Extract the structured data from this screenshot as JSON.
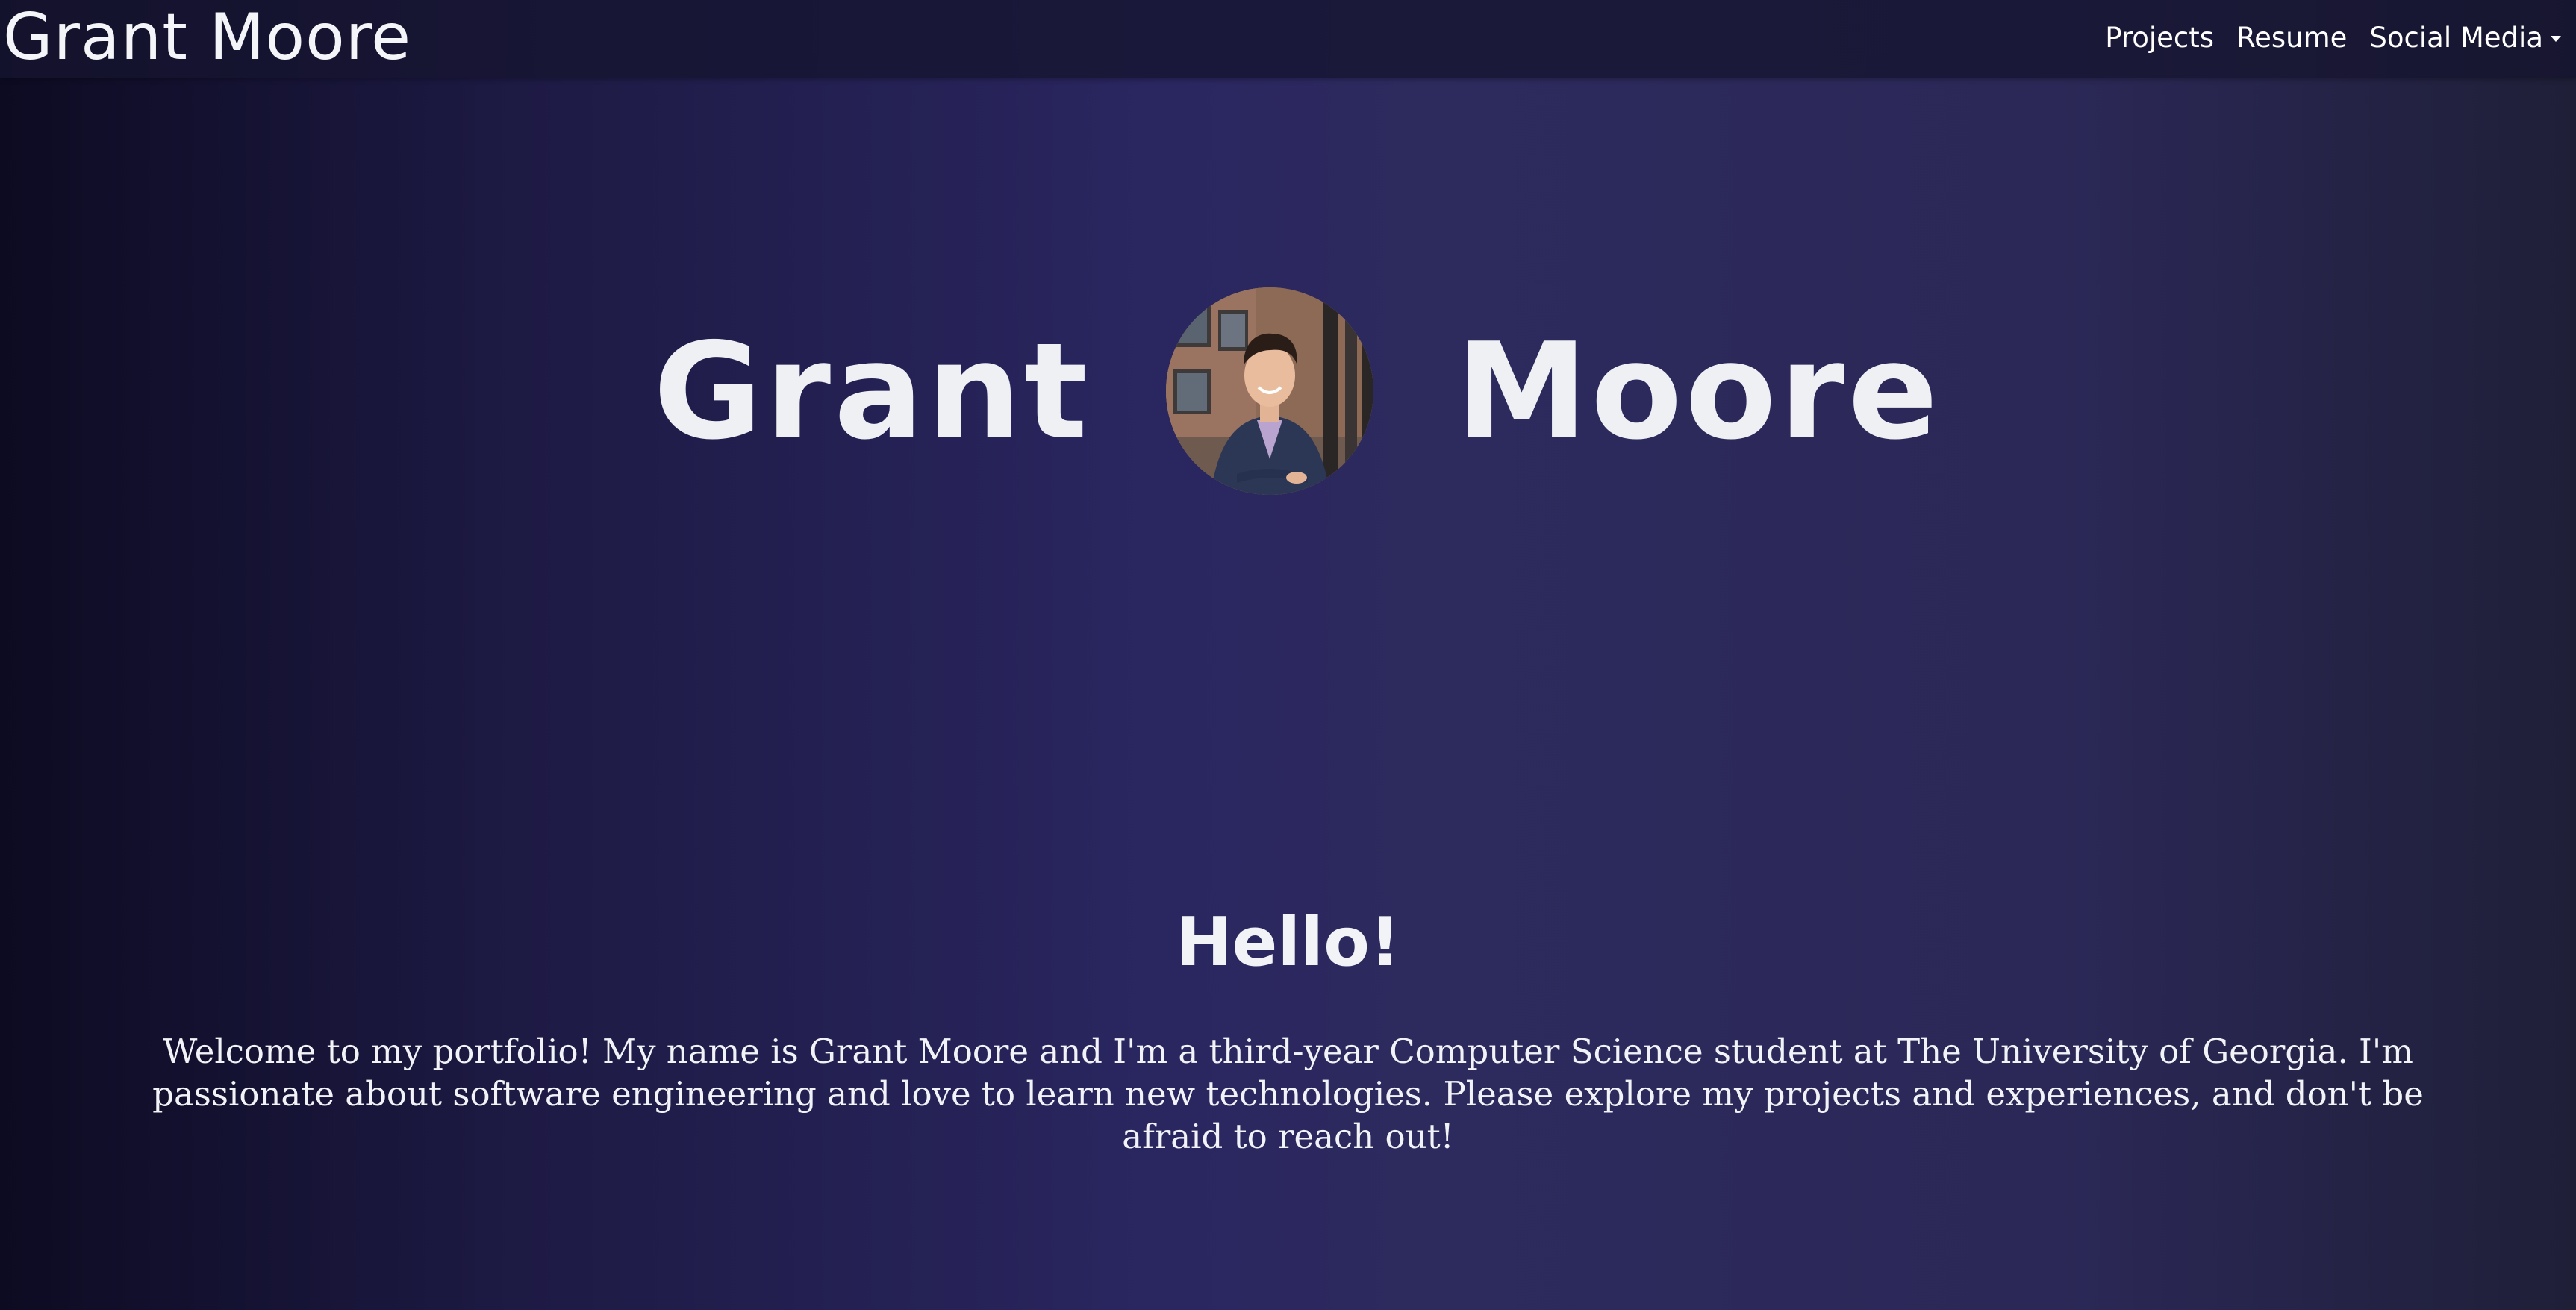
{
  "navbar": {
    "brand": "Grant Moore",
    "links": [
      {
        "label": "Projects"
      },
      {
        "label": "Resume"
      },
      {
        "label": "Social Media"
      }
    ]
  },
  "hero": {
    "first_name": "Grant",
    "last_name": "Moore",
    "avatar": "profile-photo"
  },
  "intro": {
    "heading": "Hello!",
    "text": "Welcome to my portfolio! My name is Grant Moore and I'm a third-year Computer Science student at The University of Georgia. I'm passionate about software engineering and love to learn new technologies. Please explore my projects and experiences, and don't be afraid to reach out!"
  },
  "colors": {
    "background_center": "#2d2a5e",
    "background_edge": "#0d0b22",
    "navbar": "#161530",
    "text": "#f4f5f8"
  }
}
